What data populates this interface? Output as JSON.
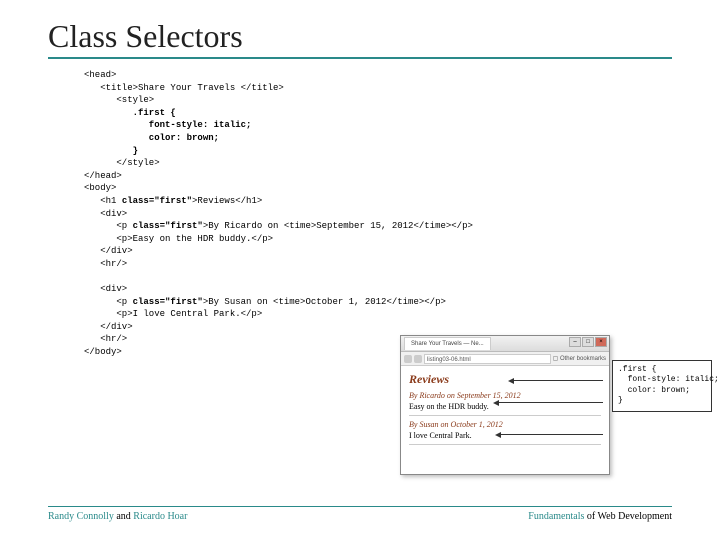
{
  "title": "Class Selectors",
  "code": {
    "l1": "<head>",
    "l2": "   <title>Share Your Travels </title>",
    "l3": "      <style>",
    "l4": "         .first {",
    "l5": "            font-style: italic;",
    "l6": "            color: brown;",
    "l7": "         }",
    "l8": "      </style>",
    "l9": "</head>",
    "l10": "<body>",
    "l11a": "   <h1 ",
    "l11b": "class=\"first\"",
    "l11c": ">Reviews</h1>",
    "l12": "   <div>",
    "l13a": "      <p ",
    "l13b": "class=\"first\"",
    "l13c": ">By Ricardo on <time>September 15, 2012</time></p>",
    "l14": "      <p>Easy on the HDR buddy.</p>",
    "l15": "   </div>",
    "l16": "   <hr/>",
    "blank": "",
    "l17": "   <div>",
    "l18a": "      <p ",
    "l18b": "class=\"first\"",
    "l18c": ">By Susan on <time>October 1, 2012</time></p>",
    "l19": "      <p>I love Central Park.</p>",
    "l20": "   </div>",
    "l21": "   <hr/>",
    "l22": "</body>"
  },
  "screenshot": {
    "tab": "Share Your Travels — Ne...",
    "url": "listing03-06.html",
    "bookmark": "Other bookmarks",
    "h1": "Reviews",
    "p1a": "By Ricardo on September 15, 2012",
    "p1b": "Easy on the HDR buddy.",
    "p2a": "By Susan on October 1, 2012",
    "p2b": "I love Central Park."
  },
  "callout": ".first {\n  font-style: italic;\n  color: brown;\n}",
  "footer": {
    "left_a": "Randy Connolly",
    "left_mid": " and ",
    "left_b": "Ricardo Hoar",
    "right_a": "Fundamentals",
    "right_b": " of Web Development"
  }
}
